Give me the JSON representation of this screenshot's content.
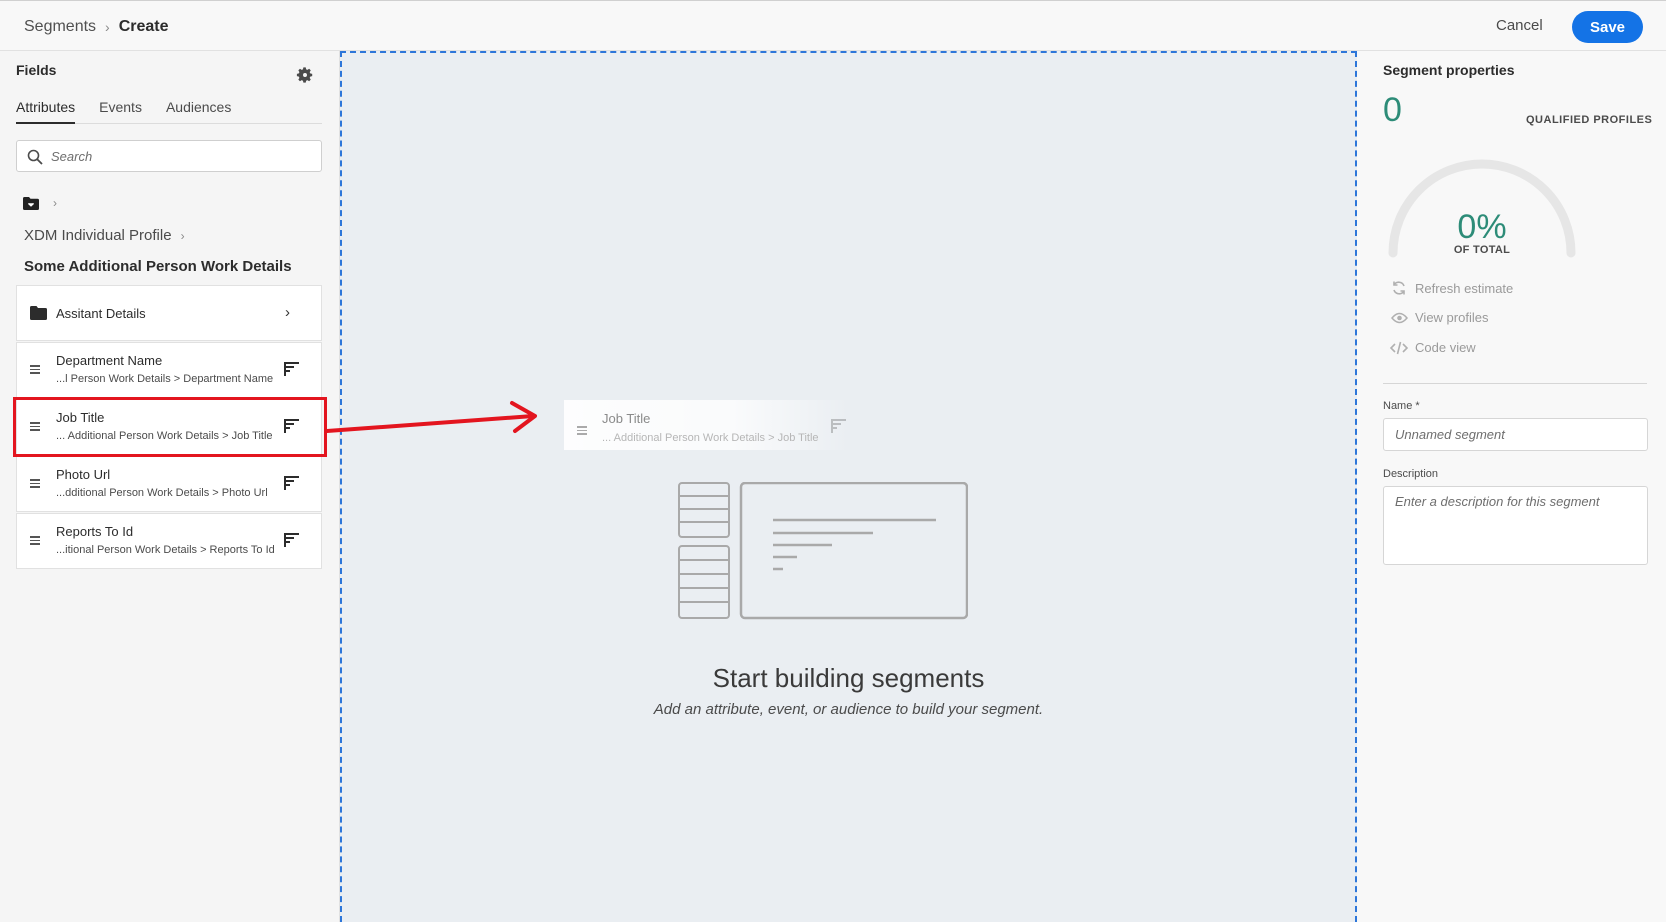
{
  "header": {
    "breadcrumb_root": "Segments",
    "breadcrumb_current": "Create",
    "cancel_label": "Cancel",
    "save_label": "Save"
  },
  "fields_panel": {
    "title": "Fields",
    "tabs": [
      "Attributes",
      "Events",
      "Audiences"
    ],
    "search_placeholder": "Search",
    "schema_name": "XDM Individual Profile",
    "group_title": "Some Additional Person Work Details",
    "items": [
      {
        "label": "Assitant Details",
        "type": "folder"
      },
      {
        "label": "Department Name",
        "path": "...l Person Work Details > Department Name",
        "type": "field"
      },
      {
        "label": "Job Title",
        "path": "... Additional Person Work Details > Job Title",
        "type": "field"
      },
      {
        "label": "Photo Url",
        "path": "...dditional Person Work Details > Photo Url",
        "type": "field"
      },
      {
        "label": "Reports To Id",
        "path": "...itional Person Work Details > Reports To Id",
        "type": "field"
      }
    ]
  },
  "canvas": {
    "drag_item": {
      "label": "Job Title",
      "path": "... Additional Person Work Details > Job Title"
    },
    "empty_title": "Start building segments",
    "empty_subtitle": "Add an attribute, event, or audience to build your segment."
  },
  "properties": {
    "title": "Segment properties",
    "qualified_count": "0",
    "qualified_label": "QUALIFIED PROFILES",
    "percent": "0%",
    "percent_label": "OF TOTAL",
    "actions": [
      "Refresh estimate",
      "View profiles",
      "Code view"
    ],
    "name_label": "Name *",
    "name_placeholder": "Unnamed segment",
    "description_label": "Description",
    "description_placeholder": "Enter a description for this segment"
  },
  "colors": {
    "accent": "#1473e6",
    "highlight": "#e3151f",
    "metric": "#2d8c78",
    "drop_border": "#2d76d9"
  }
}
